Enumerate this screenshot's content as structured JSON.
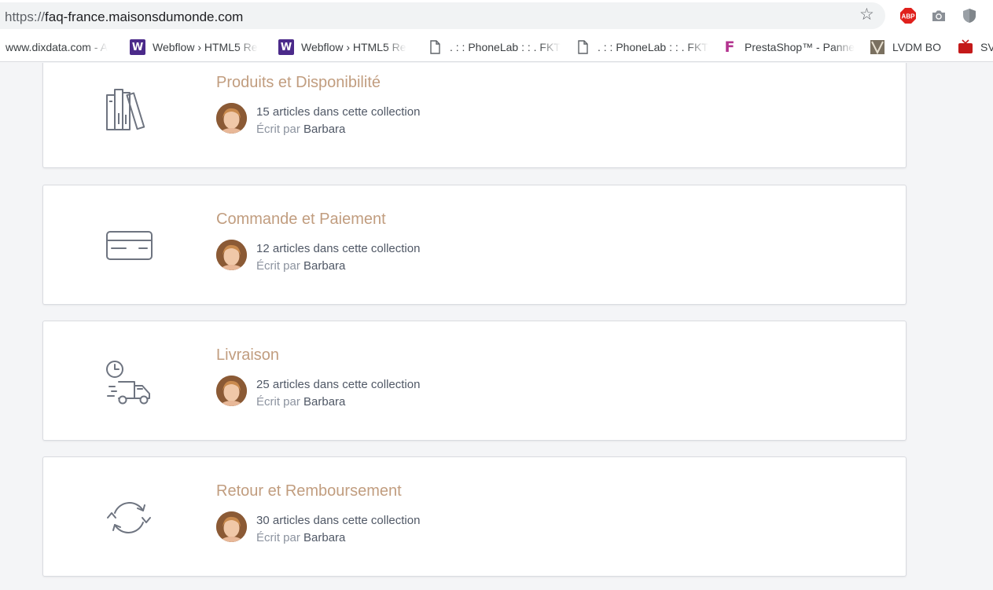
{
  "browser": {
    "url_scheme": "https://",
    "url_host": "faq-france.maisonsdumonde.com",
    "star_icon": "bookmark-star-icon",
    "extensions": [
      {
        "name": "adblock-plus-icon",
        "label": "ABP",
        "color": "#e0201c"
      },
      {
        "name": "camera-icon"
      },
      {
        "name": "shield-icon"
      }
    ]
  },
  "bookmarks": [
    {
      "label": "www.dixdata.com - A",
      "icon": "none"
    },
    {
      "label": "Webflow › HTML5 Re",
      "icon": "webflow-icon",
      "icon_text": "W"
    },
    {
      "label": "Webflow › HTML5 Re",
      "icon": "webflow-icon",
      "icon_text": "W"
    },
    {
      "label": ". : : PhoneLab : : . FKT",
      "icon": "page-icon"
    },
    {
      "label": ". : : PhoneLab : : . FKT",
      "icon": "page-icon"
    },
    {
      "label": "PrestaShop™ - Panne",
      "icon": "prestashop-icon",
      "icon_text": "F"
    },
    {
      "label": "LVDM BO",
      "icon": "lvdm-icon"
    },
    {
      "label": "SV",
      "icon": "tv-icon"
    }
  ],
  "collections": [
    {
      "title": "Produits et Disponibilité",
      "articles": "15 articles dans cette collection",
      "by": "Écrit par",
      "author": "Barbara",
      "icon": "books-icon"
    },
    {
      "title": "Commande et Paiement",
      "articles": "12 articles dans cette collection",
      "by": "Écrit par",
      "author": "Barbara",
      "icon": "credit-card-icon"
    },
    {
      "title": "Livraison",
      "articles": "25 articles dans cette collection",
      "by": "Écrit par",
      "author": "Barbara",
      "icon": "delivery-truck-icon"
    },
    {
      "title": "Retour et Remboursement",
      "articles": "30 articles dans cette collection",
      "by": "Écrit par",
      "author": "Barbara",
      "icon": "refresh-arrows-icon"
    }
  ],
  "colors": {
    "accent_title": "#c19d7f",
    "icon_stroke": "#6e7480",
    "text": "#505866",
    "muted": "#8c939f",
    "background": "#f4f5f7"
  }
}
